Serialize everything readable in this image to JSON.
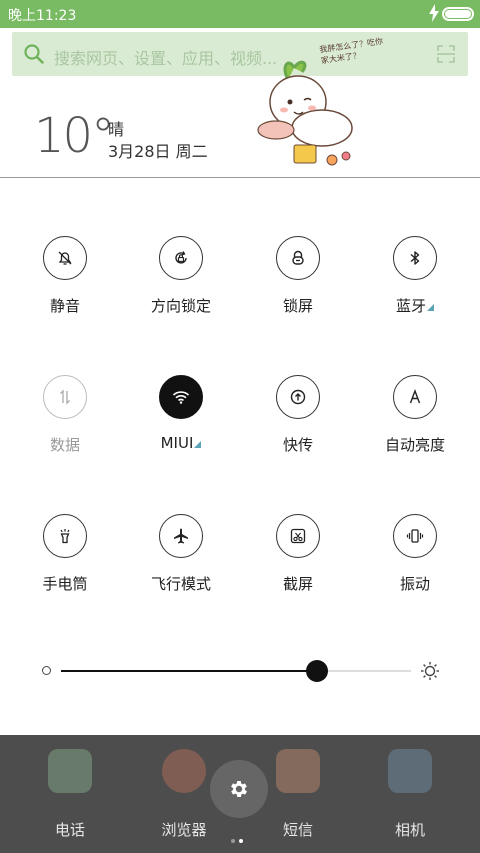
{
  "status_bar": {
    "time": "晚上11:23",
    "battery_level": 1.0
  },
  "search": {
    "placeholder": "搜索网页、设置、应用、视频..."
  },
  "weather": {
    "temperature": "10°",
    "condition": "晴",
    "date": "3月28日 周二"
  },
  "sticker": {
    "caption": "我胖怎么了？吃你家大米了？"
  },
  "toggles": [
    {
      "label": "静音",
      "icon": "mute-bell-icon",
      "state": "normal"
    },
    {
      "label": "方向锁定",
      "icon": "rotation-lock-icon",
      "state": "normal"
    },
    {
      "label": "锁屏",
      "icon": "lock-icon",
      "state": "normal"
    },
    {
      "label": "蓝牙",
      "icon": "bluetooth-icon",
      "state": "normal",
      "has_more": true
    },
    {
      "label": "数据",
      "icon": "mobile-data-icon",
      "state": "disabled"
    },
    {
      "label": "MIUI",
      "icon": "wifi-icon",
      "state": "on",
      "has_more": true
    },
    {
      "label": "快传",
      "icon": "quick-transfer-icon",
      "state": "normal"
    },
    {
      "label": "自动亮度",
      "icon": "auto-brightness-icon",
      "state": "normal"
    },
    {
      "label": "手电筒",
      "icon": "flashlight-icon",
      "state": "normal"
    },
    {
      "label": "飞行模式",
      "icon": "airplane-icon",
      "state": "normal"
    },
    {
      "label": "截屏",
      "icon": "screenshot-icon",
      "state": "normal"
    },
    {
      "label": "振动",
      "icon": "vibrate-icon",
      "state": "normal"
    }
  ],
  "brightness": {
    "level": 0.73
  },
  "dock": {
    "apps": [
      {
        "name": "电话",
        "icon": "phone-app-icon"
      },
      {
        "name": "浏览器",
        "icon": "browser-app-icon"
      },
      {
        "name": "短信",
        "icon": "messages-app-icon"
      },
      {
        "name": "相机",
        "icon": "camera-app-icon"
      }
    ],
    "settings_icon": "gear-icon",
    "pages": 2,
    "active_page": 2
  },
  "colors": {
    "status_green": "#79bb62",
    "search_bg": "#d9ecd3",
    "dock_bg": "#4d4d4d",
    "accent_teal": "#5aa3b5"
  }
}
